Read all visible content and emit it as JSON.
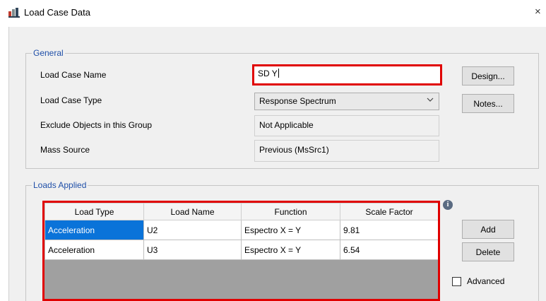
{
  "window": {
    "title": "Load Case Data",
    "close_glyph": "×"
  },
  "general": {
    "legend": "General",
    "load_case_name": {
      "label": "Load Case Name",
      "value": "SD Y"
    },
    "load_case_type": {
      "label": "Load Case Type",
      "value": "Response Spectrum"
    },
    "exclude_objects": {
      "label": "Exclude Objects in this Group",
      "value": "Not Applicable"
    },
    "mass_source": {
      "label": "Mass Source",
      "value": "Previous (MsSrc1)"
    },
    "design_button": "Design...",
    "notes_button": "Notes..."
  },
  "loads_applied": {
    "legend": "Loads Applied",
    "columns": [
      "Load Type",
      "Load Name",
      "Function",
      "Scale Factor"
    ],
    "rows": [
      {
        "load_type": "Acceleration",
        "load_name": "U2",
        "function": "Espectro X = Y",
        "scale_factor": "9.81"
      },
      {
        "load_type": "Acceleration",
        "load_name": "U3",
        "function": "Espectro X = Y",
        "scale_factor": "6.54"
      }
    ],
    "add_button": "Add",
    "delete_button": "Delete",
    "advanced_label": "Advanced",
    "advanced_checked": false
  },
  "colors": {
    "highlight_border": "#e00000",
    "selected_cell": "#0a73d9",
    "group_legend": "#1f4fa8"
  },
  "icons": [
    "app-icon",
    "info-icon",
    "close-icon",
    "chevron-down-icon"
  ]
}
